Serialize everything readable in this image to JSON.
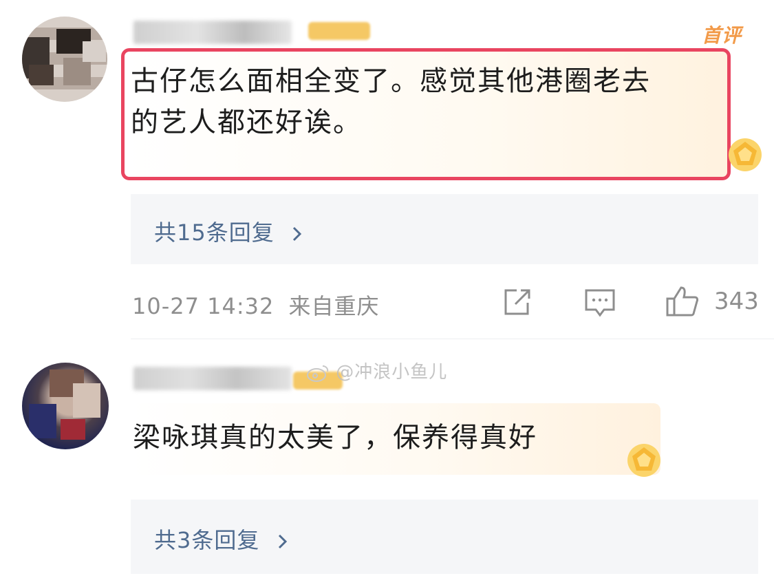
{
  "comments": [
    {
      "text_line1": "古仔怎么面相全变了。感觉其他港圈老去",
      "text_line2": "的艺人都还好诶。",
      "badge_label": "首评",
      "replies_label": "共15条回复",
      "timestamp": "10-27 14:32",
      "location": "来自重庆",
      "likes": "343"
    },
    {
      "text": "梁咏琪真的太美了，保养得真好",
      "replies_label": "共3条回复"
    }
  ],
  "watermark": "@冲浪小鱼儿",
  "colors": {
    "highlight_border": "#e94560",
    "reply_link": "#4f6b8f",
    "first_badge": "#f29a49"
  },
  "icons": [
    "share-icon",
    "comment-icon",
    "like-icon",
    "chevron-right-icon",
    "medal-icon",
    "weibo-logo-icon"
  ]
}
